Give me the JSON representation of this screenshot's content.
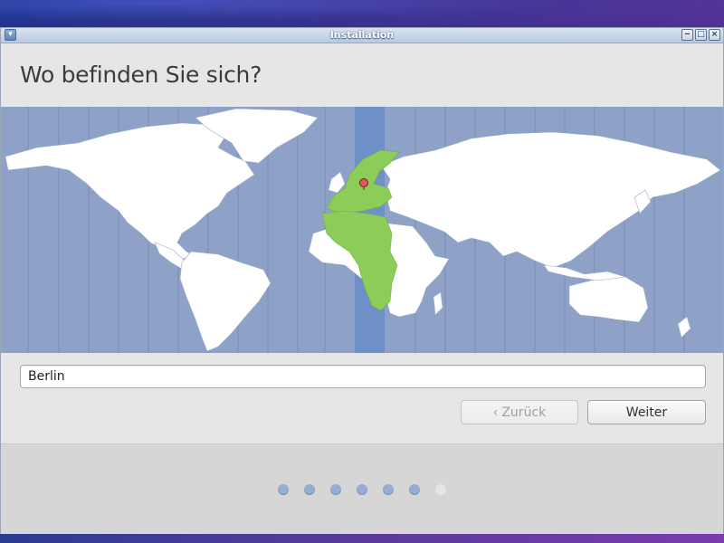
{
  "window": {
    "title": "Installation",
    "controls": {
      "minimize_icon": "minimize-icon",
      "maximize_icon": "maximize-icon",
      "close_icon": "close-icon"
    }
  },
  "page": {
    "heading": "Wo befinden Sie sich?"
  },
  "map": {
    "selected_timezone_band_color": "#6f8fc9",
    "highlight_color": "#8ccd5a",
    "marker_color": "#e25a5a"
  },
  "location_input": {
    "value": "Berlin"
  },
  "buttons": {
    "back_label": "Zurück",
    "back_icon": "chevron-left-icon",
    "next_label": "Weiter"
  },
  "progress": {
    "total_steps": 7,
    "completed_steps": 6
  }
}
